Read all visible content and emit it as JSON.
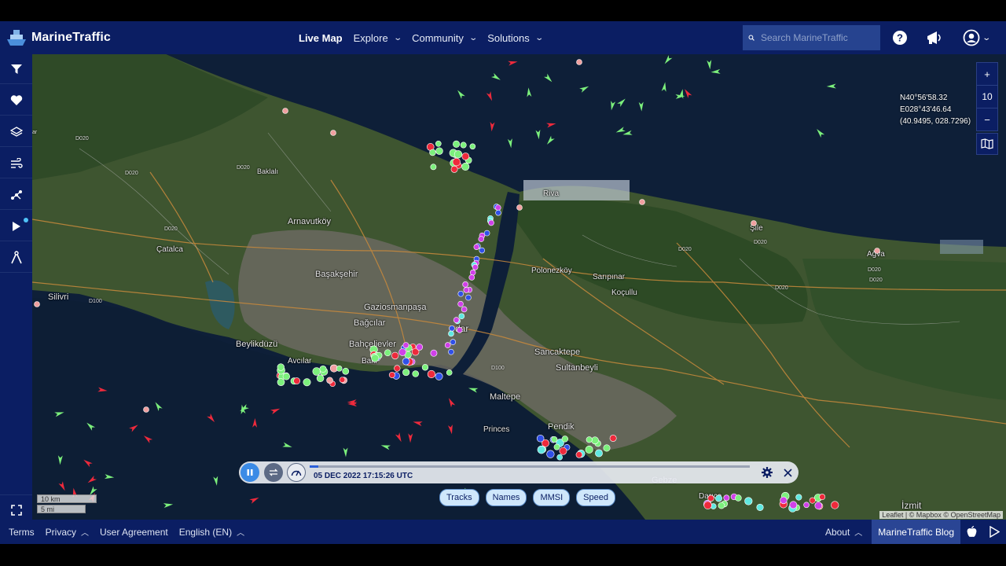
{
  "app": {
    "name": "MarineTraffic",
    "brand_color": "#0b1e63",
    "accent_color": "#2b5fd9"
  },
  "nav": {
    "items": [
      {
        "label": "Live Map"
      },
      {
        "label": "Explore"
      },
      {
        "label": "Community"
      },
      {
        "label": "Solutions"
      }
    ]
  },
  "search": {
    "placeholder": "Search MarineTraffic"
  },
  "header_icons": [
    "help-icon",
    "megaphone-icon",
    "user-icon"
  ],
  "sidebar": {
    "items": [
      "filter-icon",
      "heart-icon",
      "layers-icon",
      "wind-icon",
      "routes-icon",
      "play-icon",
      "measure-icon"
    ],
    "bottom": "fullscreen-icon"
  },
  "map": {
    "zoom_level": "10",
    "coords": {
      "lat": "N40°56'58.32",
      "lon": "E028°43'46.64",
      "decimal": "(40.9495, 028.7296)"
    },
    "places": [
      "Riva",
      "Şile",
      "Ağva",
      "Arnavutköy",
      "Başakşehir",
      "Çatalca",
      "Silivri",
      "Beylikdüzü",
      "Avcılar",
      "Gaziosmanpaşa",
      "Bağcılar",
      "Bahçelievler",
      "Bakı",
      "Polonezköy",
      "Sarıpınar",
      "Koçullu",
      "Sancaktepe",
      "Sultanbeyli",
      "Maltepe",
      "Pendik",
      "Princes",
      "Gebze",
      "Darıca",
      "İzmit",
      "Baklalı",
      "dar"
    ],
    "road_labels": [
      "D020",
      "D020",
      "D020",
      "D020",
      "D020",
      "D020",
      "D100",
      "D100",
      "D020",
      "D020",
      "D020",
      "ar"
    ],
    "scale": {
      "km": "10 km",
      "mi": "5 mi"
    },
    "attribution": "Leaflet | © Mapbox © OpenStreetMap"
  },
  "playback": {
    "timestamp": "05 DEC 2022 17:15:26 UTC",
    "progress": 0.02,
    "toggles": [
      "Tracks",
      "Names",
      "MMSI",
      "Speed"
    ]
  },
  "footer": {
    "left": [
      {
        "label": "Terms"
      },
      {
        "label": "Privacy",
        "chevron": true
      },
      {
        "label": "User Agreement"
      },
      {
        "label": "English (EN)",
        "chevron": true
      }
    ],
    "about": "About",
    "blog": "MarineTraffic Blog"
  }
}
